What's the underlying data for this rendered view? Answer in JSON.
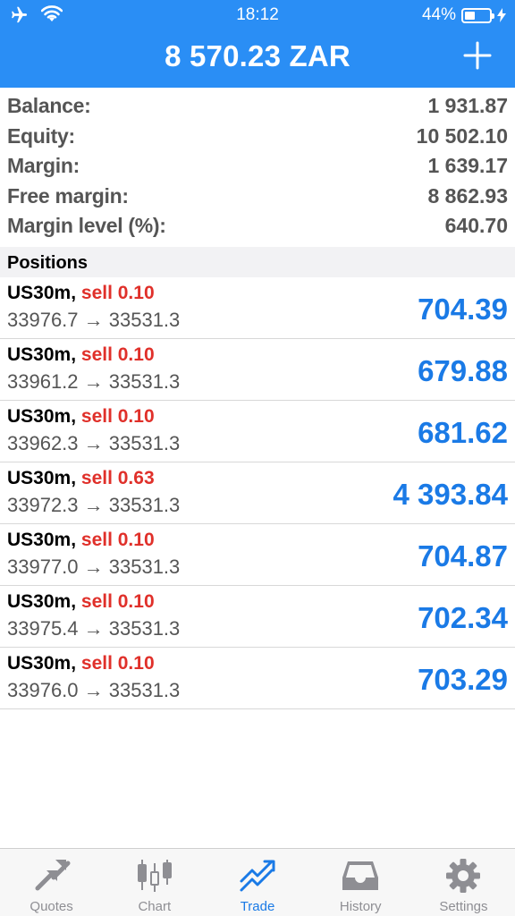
{
  "status_bar": {
    "time": "18:12",
    "battery": "44%",
    "battery_level": 0.44
  },
  "header": {
    "title": "8 570.23 ZAR"
  },
  "summary": [
    {
      "label": "Balance:",
      "value": "1 931.87"
    },
    {
      "label": "Equity:",
      "value": "10 502.10"
    },
    {
      "label": "Margin:",
      "value": "1 639.17"
    },
    {
      "label": "Free margin:",
      "value": "8 862.93"
    },
    {
      "label": "Margin level (%):",
      "value": "640.70"
    }
  ],
  "positions_header": "Positions",
  "positions": [
    {
      "symbol": "US30m,",
      "side": "sell 0.10",
      "prices": "33976.7 → 33531.3",
      "profit": "704.39"
    },
    {
      "symbol": "US30m,",
      "side": "sell 0.10",
      "prices": "33961.2 → 33531.3",
      "profit": "679.88"
    },
    {
      "symbol": "US30m,",
      "side": "sell 0.10",
      "prices": "33962.3 → 33531.3",
      "profit": "681.62"
    },
    {
      "symbol": "US30m,",
      "side": "sell 0.63",
      "prices": "33972.3 → 33531.3",
      "profit": "4 393.84"
    },
    {
      "symbol": "US30m,",
      "side": "sell 0.10",
      "prices": "33977.0 → 33531.3",
      "profit": "704.87"
    },
    {
      "symbol": "US30m,",
      "side": "sell 0.10",
      "prices": "33975.4 → 33531.3",
      "profit": "702.34"
    },
    {
      "symbol": "US30m,",
      "side": "sell 0.10",
      "prices": "33976.0 → 33531.3",
      "profit": "703.29"
    }
  ],
  "tabs": [
    {
      "label": "Quotes",
      "icon": "quotes-arrows-icon",
      "active": false
    },
    {
      "label": "Chart",
      "icon": "candlestick-chart-icon",
      "active": false
    },
    {
      "label": "Trade",
      "icon": "trade-trend-icon",
      "active": true
    },
    {
      "label": "History",
      "icon": "inbox-tray-icon",
      "active": false
    },
    {
      "label": "Settings",
      "icon": "gear-icon",
      "active": false
    }
  ],
  "colors": {
    "header_blue": "#2a8ef5",
    "sell_red": "#e0302a",
    "profit_blue": "#1a7ae6",
    "tab_inactive": "#8e8e93"
  }
}
